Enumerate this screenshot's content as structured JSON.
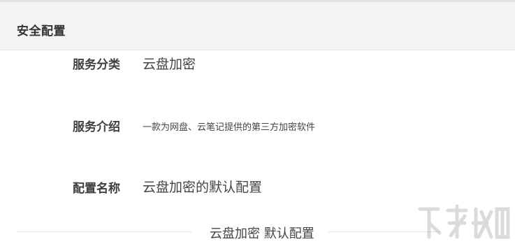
{
  "header": {
    "title": "安全配置"
  },
  "fields": [
    {
      "label": "服务分类",
      "value": "云盘加密"
    },
    {
      "label": "服务介绍",
      "value": "一款为网盘、云笔记提供的第三方加密软件"
    },
    {
      "label": "配置名称",
      "value": "云盘加密的默认配置"
    }
  ],
  "section_divider": {
    "text": "云盘加密 默认配置"
  }
}
